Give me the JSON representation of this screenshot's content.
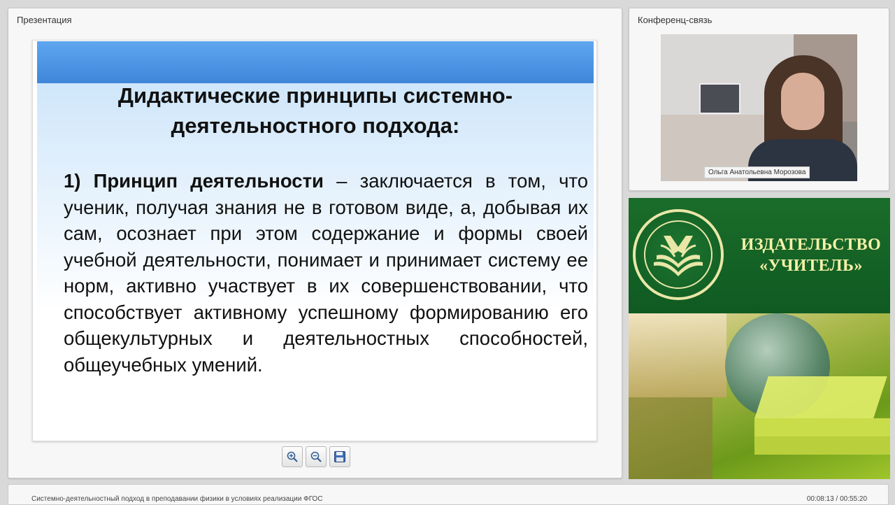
{
  "presentation": {
    "title": "Презентация",
    "slide": {
      "heading": "Дидактические принципы системно-деятельностного подхода:",
      "principle_title": "1) Принцип деятельности",
      "principle_text": " – заключается в том, что ученик, получая знания не в готовом виде, а, добывая их сам, осознает при этом содержание и формы своей учебной деятельности, понимает и принимает систему ее норм, активно участвует в их совершенствовании, что способствует активному успешному формированию его общекультурных и деятельностных способностей, общеучебных умений."
    },
    "toolbar": {
      "zoom_in_icon": "zoom-in-icon",
      "zoom_out_icon": "zoom-out-icon",
      "save_icon": "floppy-save-icon"
    }
  },
  "conference": {
    "title": "Конференц-связь",
    "speaker_name": "Ольга Анатольевна Морозова"
  },
  "advert": {
    "brand_line1": "ИЗДАТЕЛЬСТВО",
    "brand_line2": "«УЧИТЕЛЬ»"
  },
  "footer": {
    "webinar_title": "Системно-деятельностный подход в преподавании физики в условиях реализации ФГОС",
    "time": "00:08:13 / 00:55:20"
  },
  "colors": {
    "slide_band": "#3f86da",
    "ad_green": "#0f5a22",
    "ad_text": "#f6f1a8"
  }
}
